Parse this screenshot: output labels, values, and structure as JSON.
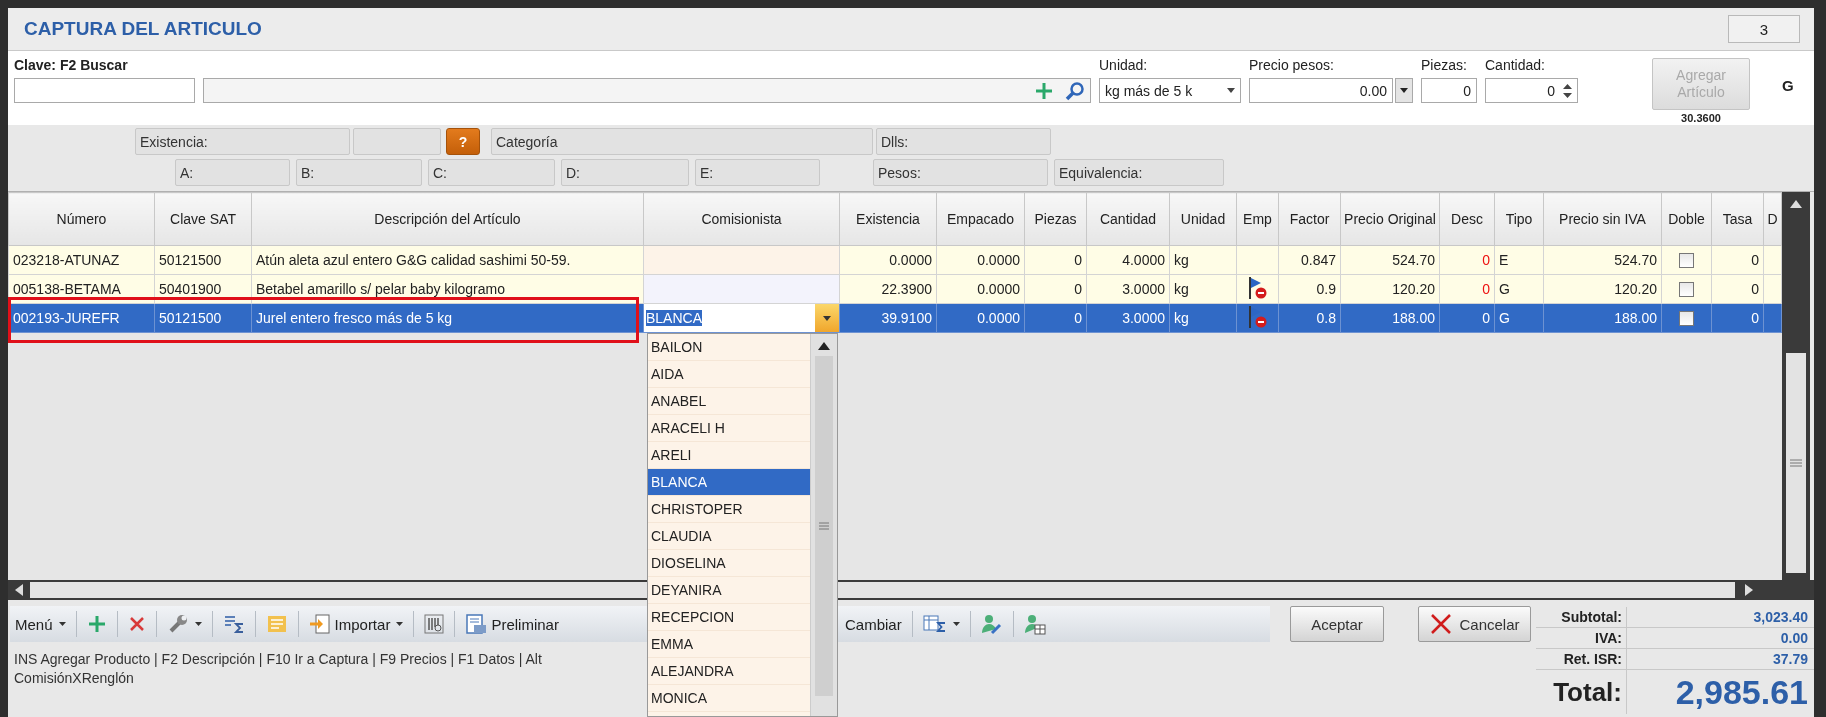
{
  "title": "CAPTURA DEL ARTICULO",
  "page_number": "3",
  "form": {
    "clave_label": "Clave:  F2 Buscar",
    "unidad": {
      "label": "Unidad:",
      "value": "kg más de 5 k"
    },
    "precio": {
      "label": "Precio pesos:",
      "value": "0.00"
    },
    "piezas": {
      "label": "Piezas:",
      "value": "0"
    },
    "cantidad": {
      "label": "Cantidad:",
      "value": "0"
    },
    "add_button": {
      "label": "Agregar Artículo",
      "disabled": true
    },
    "add_note": "30.3600",
    "tipo": "G"
  },
  "info": {
    "row1": [
      {
        "kind": "text",
        "label": "Existencia:"
      },
      {
        "kind": "blank"
      },
      {
        "kind": "help",
        "label": "?"
      },
      {
        "kind": "text",
        "label": "Categoría"
      },
      {
        "kind": "text",
        "label": "Dlls:"
      }
    ],
    "row2": [
      {
        "kind": "text",
        "label": "A:"
      },
      {
        "kind": "text",
        "label": "B:"
      },
      {
        "kind": "text",
        "label": "C:"
      },
      {
        "kind": "text",
        "label": "D:"
      },
      {
        "kind": "text",
        "label": "E:"
      },
      {
        "kind": "text",
        "label": "Pesos:"
      },
      {
        "kind": "text",
        "label": "Equivalencia:"
      }
    ]
  },
  "grid": {
    "columns": [
      "Número",
      "Clave SAT",
      "Descripción del Artículo",
      "Comisionista",
      "Existencia",
      "Empacado",
      "Piezas",
      "Cantidad",
      "Unidad",
      "Emp",
      "Factor",
      "Precio Original",
      "Desc",
      "Tipo",
      "Precio sin IVA",
      "Doble",
      "Tasa",
      "D"
    ],
    "rows": [
      {
        "numero": "023218-ATUNAZ",
        "clave_sat": "50121500",
        "descripcion": "Atún aleta azul entero G&G calidad sashimi 50-59.",
        "existencia": "0.0000",
        "empacado": "0.0000",
        "piezas": "0",
        "cantidad": "4.0000",
        "unidad": "kg",
        "emp_flag": false,
        "factor": "0.847",
        "precio_original": "524.70",
        "desc": "0",
        "tipo": "E",
        "precio_sin_iva": "524.70",
        "doble_checked": false,
        "tasa": "0",
        "selected": false,
        "editing": false,
        "highlighted": false
      },
      {
        "numero": "005138-BETAMA",
        "clave_sat": "50401900",
        "descripcion": "Betabel amarillo s/ pelar baby kilogramo",
        "existencia": "22.3900",
        "empacado": "0.0000",
        "piezas": "0",
        "cantidad": "3.0000",
        "unidad": "kg",
        "emp_flag": true,
        "factor": "0.9",
        "precio_original": "120.20",
        "desc": "0",
        "tipo": "G",
        "precio_sin_iva": "120.20",
        "doble_checked": false,
        "tasa": "0",
        "selected": false,
        "editing": false,
        "highlighted": false
      },
      {
        "numero": "002193-JUREFR",
        "clave_sat": "50121500",
        "descripcion": "Jurel entero fresco más de 5 kg",
        "comisionista": "BLANCA",
        "existencia": "39.9100",
        "empacado": "0.0000",
        "piezas": "0",
        "cantidad": "3.0000",
        "unidad": "kg",
        "emp_flag": true,
        "factor": "0.8",
        "precio_original": "188.00",
        "desc": "0",
        "tipo": "G",
        "precio_sin_iva": "188.00",
        "doble_checked": false,
        "tasa": "0",
        "selected": true,
        "editing": true,
        "highlighted": true
      }
    ]
  },
  "dropdown": {
    "items": [
      {
        "label": "BAILON",
        "selected": false
      },
      {
        "label": "AIDA",
        "selected": false
      },
      {
        "label": "ANABEL",
        "selected": false
      },
      {
        "label": "ARACELI H",
        "selected": false
      },
      {
        "label": "ARELI",
        "selected": false
      },
      {
        "label": "BLANCA",
        "selected": true
      },
      {
        "label": "CHRISTOPER",
        "selected": false
      },
      {
        "label": "CLAUDIA",
        "selected": false
      },
      {
        "label": "DIOSELINA",
        "selected": false
      },
      {
        "label": "DEYANIRA",
        "selected": false
      },
      {
        "label": "RECEPCION",
        "selected": false
      },
      {
        "label": "EMMA",
        "selected": false
      },
      {
        "label": "ALEJANDRA",
        "selected": false
      },
      {
        "label": "MONICA",
        "selected": false
      }
    ]
  },
  "toolbar": {
    "left": [
      {
        "kind": "menu",
        "label": "Menú",
        "dropdown": true
      },
      {
        "kind": "add",
        "dropdown": false
      },
      {
        "kind": "delete",
        "dropdown": false
      },
      {
        "kind": "tools",
        "dropdown": true
      },
      {
        "kind": "summary",
        "dropdown": false
      },
      {
        "kind": "notes",
        "dropdown": false
      },
      {
        "kind": "import",
        "label": "Importar",
        "dropdown": true
      },
      {
        "kind": "barcode",
        "dropdown": false
      },
      {
        "kind": "preview",
        "label": "Preliminar",
        "dropdown": false
      }
    ],
    "right": [
      {
        "kind": "text",
        "label": "Cambiar",
        "dropdown": false
      },
      {
        "kind": "sumtable",
        "dropdown": true
      },
      {
        "kind": "useredit",
        "dropdown": false
      },
      {
        "kind": "usergrid",
        "dropdown": false
      }
    ]
  },
  "buttons": [
    {
      "kind": "accept",
      "label": "Aceptar"
    },
    {
      "kind": "cancel",
      "label": "Cancelar"
    }
  ],
  "status_lines": [
    "INS Agregar Producto | F2 Descripción | F10 Ir a Captura | F9 Precios | F1 Datos | Alt",
    "ComisiónXRenglón"
  ],
  "totals": [
    {
      "kind": "small",
      "label": "Subtotal:",
      "value": "3,023.40"
    },
    {
      "kind": "small",
      "label": "IVA:",
      "value": "0.00"
    },
    {
      "kind": "small",
      "label": "Ret. ISR:",
      "value": "37.79"
    },
    {
      "kind": "grand",
      "label": "Total:",
      "value": "2,985.61"
    }
  ]
}
